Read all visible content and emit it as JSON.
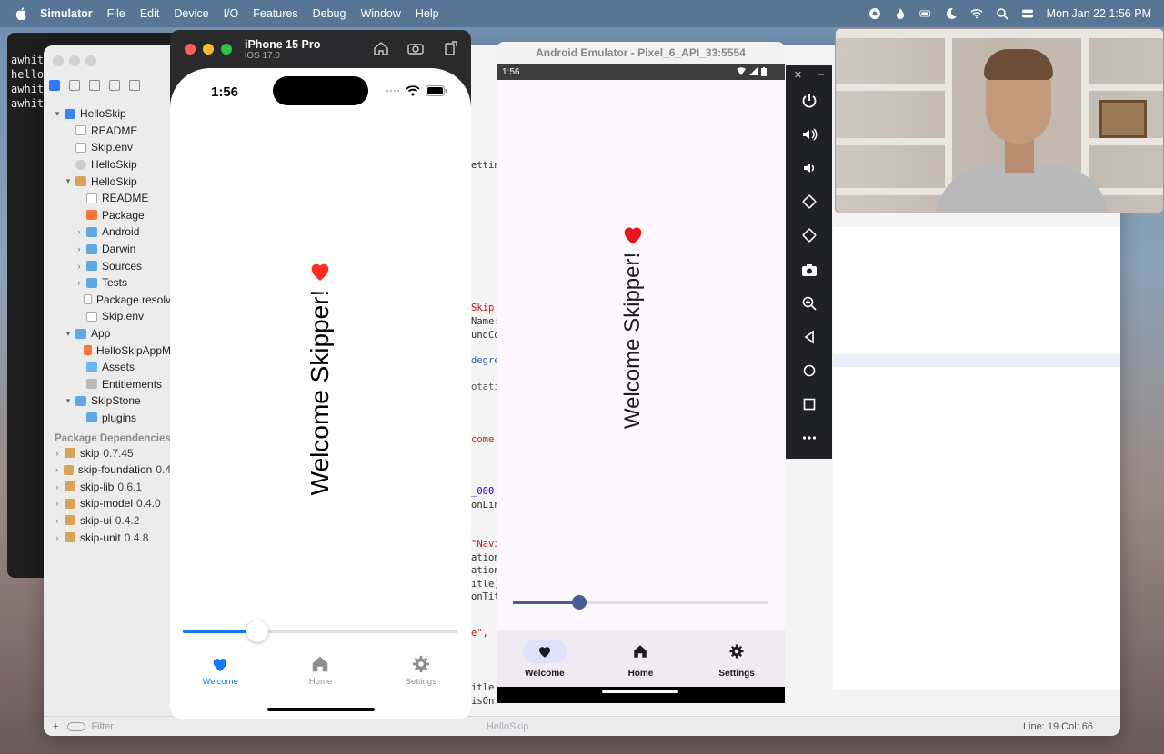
{
  "menubar": {
    "app_name": "Simulator",
    "items": [
      "File",
      "Edit",
      "Device",
      "I/O",
      "Features",
      "Debug",
      "Window",
      "Help"
    ],
    "datetime": "Mon Jan 22  1:56 PM"
  },
  "terminal": {
    "lines": [
      "awhit",
      "hello",
      "awhit",
      "awhit"
    ]
  },
  "xcode": {
    "tree": [
      {
        "label": "HelloSkip",
        "indent": 0,
        "icon": "proj",
        "chev": "v"
      },
      {
        "label": "README",
        "indent": 1,
        "icon": "doc",
        "chev": ""
      },
      {
        "label": "Skip.env",
        "indent": 1,
        "icon": "doc",
        "chev": ""
      },
      {
        "label": "HelloSkip",
        "indent": 1,
        "icon": "ref",
        "chev": ""
      },
      {
        "label": "HelloSkip",
        "indent": 1,
        "icon": "pkg",
        "chev": "v"
      },
      {
        "label": "README",
        "indent": 2,
        "icon": "doc",
        "chev": ""
      },
      {
        "label": "Package",
        "indent": 2,
        "icon": "swift",
        "chev": ""
      },
      {
        "label": "Android",
        "indent": 2,
        "icon": "folder",
        "chev": ">"
      },
      {
        "label": "Darwin",
        "indent": 2,
        "icon": "folder",
        "chev": ">"
      },
      {
        "label": "Sources",
        "indent": 2,
        "icon": "folder",
        "chev": ">"
      },
      {
        "label": "Tests",
        "indent": 2,
        "icon": "folder",
        "chev": ">"
      },
      {
        "label": "Package.resolv",
        "indent": 2,
        "icon": "doc",
        "chev": ""
      },
      {
        "label": "Skip.env",
        "indent": 2,
        "icon": "doc",
        "chev": ""
      },
      {
        "label": "App",
        "indent": 1,
        "icon": "folder",
        "chev": "v"
      },
      {
        "label": "HelloSkipAppM",
        "indent": 2,
        "icon": "swift",
        "chev": ""
      },
      {
        "label": "Assets",
        "indent": 2,
        "icon": "asset",
        "chev": ""
      },
      {
        "label": "Entitlements",
        "indent": 2,
        "icon": "ent",
        "chev": ""
      },
      {
        "label": "SkipStone",
        "indent": 1,
        "icon": "folder",
        "chev": "v"
      },
      {
        "label": "plugins",
        "indent": 2,
        "icon": "folder",
        "chev": ""
      }
    ],
    "deps_title": "Package Dependencies",
    "deps": [
      {
        "name": "skip",
        "version": "0.7.45"
      },
      {
        "name": "skip-foundation",
        "version": "0.4"
      },
      {
        "name": "skip-lib",
        "version": "0.6.1"
      },
      {
        "name": "skip-model",
        "version": "0.4.0"
      },
      {
        "name": "skip-ui",
        "version": "0.4.2"
      },
      {
        "name": "skip-unit",
        "version": "0.4.8"
      }
    ],
    "filter_placeholder": "Filter",
    "status_scheme": "HelloSkip",
    "line_col": "Line: 19  Col: 66",
    "code_fragments": [
      "etting",
      "Skip",
      "Name:",
      "undCol",
      "degre",
      "otatio",
      "come",
      "_000",
      "onLin",
      "\"Navi",
      "ation",
      "ation",
      "itle)",
      "onTit",
      "e\",",
      "itle",
      "isOn"
    ]
  },
  "iphone": {
    "window_title": "iPhone 15 Pro",
    "window_subtitle": "iOS 17.0",
    "time": "1:56",
    "welcome_text": "Welcome Skipper!",
    "slider_value": 0.27,
    "tabs": [
      {
        "label": "Welcome",
        "icon": "heart-icon",
        "active": true
      },
      {
        "label": "Home",
        "icon": "house-icon",
        "active": false
      },
      {
        "label": "Settings",
        "icon": "gear-icon",
        "active": false
      }
    ],
    "accent": "#1677ff"
  },
  "android": {
    "window_title": "Android Emulator - Pixel_6_API_33:5554",
    "time": "1:56",
    "welcome_text": "Welcome Skipper!",
    "slider_value": 0.26,
    "tabs": [
      {
        "label": "Welcome",
        "icon": "heart-icon",
        "active": true
      },
      {
        "label": "Home",
        "icon": "house-icon",
        "active": false
      },
      {
        "label": "Settings",
        "icon": "gear-icon",
        "active": false
      }
    ],
    "accent": "#4a5c92"
  },
  "emulator_controls": [
    "power-icon",
    "volume-up-icon",
    "volume-down-icon",
    "rotate-left-icon",
    "rotate-right-icon",
    "camera-icon",
    "zoom-icon",
    "back-icon",
    "home-icon",
    "overview-icon",
    "more-icon"
  ]
}
